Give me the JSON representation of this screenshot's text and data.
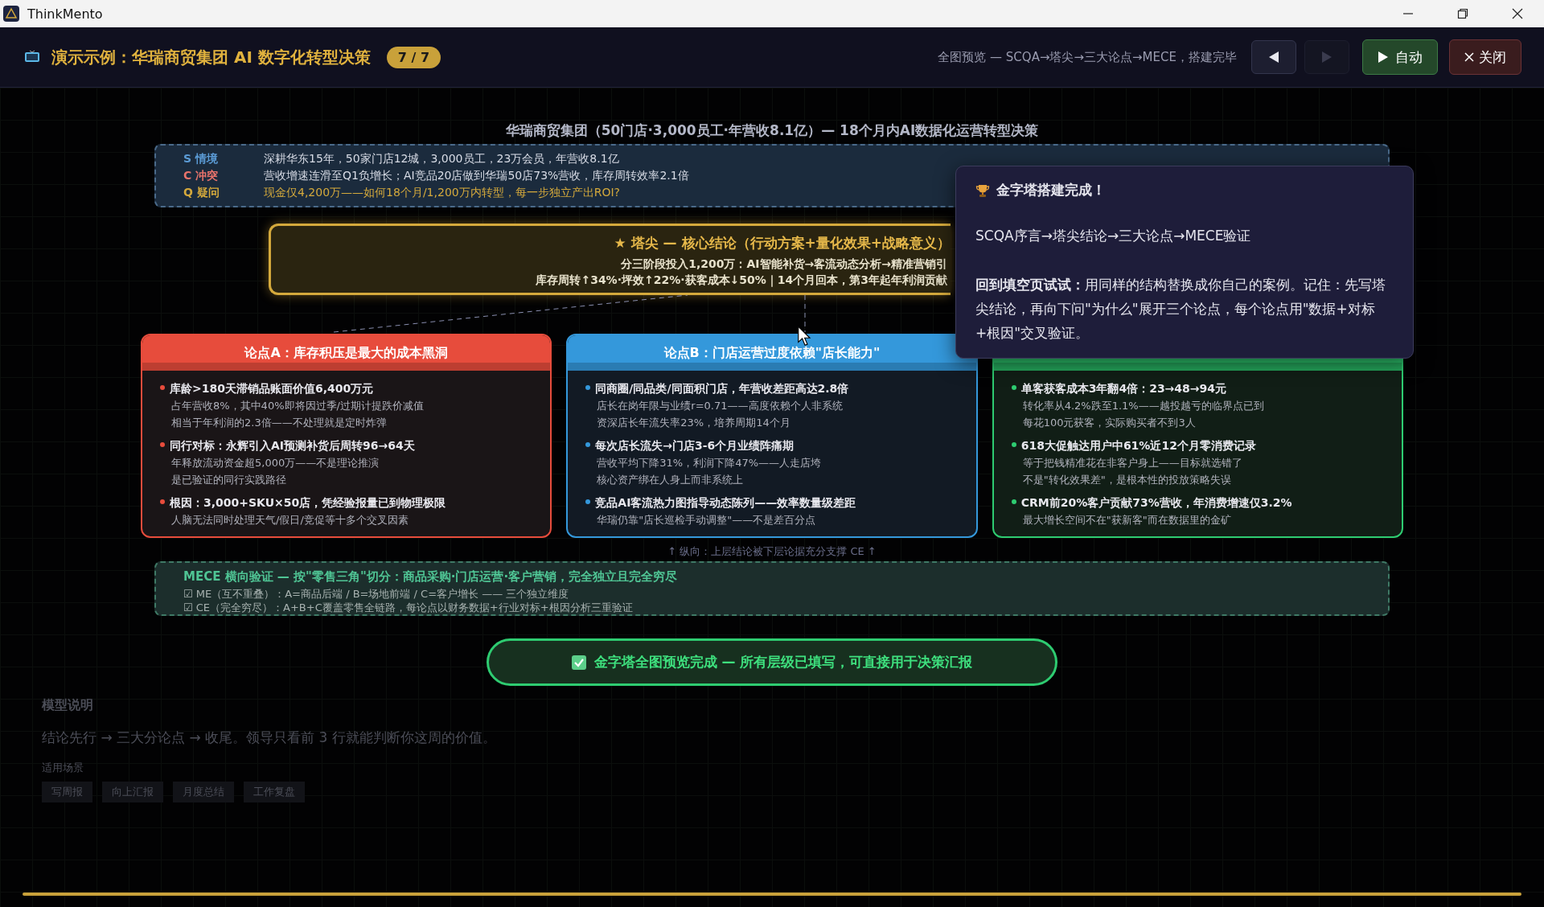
{
  "window": {
    "title": "ThinkMento"
  },
  "header": {
    "title": "演示示例：华瑞商贸集团 AI 数字化转型决策",
    "step": "7 / 7",
    "caption": "全图预览 — SCQA→塔尖→三大论点→MECE，搭建完毕",
    "prev_disabled": false,
    "next_disabled": true,
    "auto_label": "自动",
    "close_label": "关闭"
  },
  "pyramid": {
    "title": "华瑞商贸集团（50门店·3,000员工·年营收8.1亿）— 18个月内AI数据化运营转型决策",
    "scqa": [
      {
        "key": "S 情境",
        "text": "深耕华东15年，50家门店12城，3,000员工，23万会员，年营收8.1亿",
        "color": "#5b9bd5"
      },
      {
        "key": "C 冲突",
        "text": "营收增速连滑至Q1负增长；AI竞品20店做到华瑞50店73%营收，库存周转效率2.1倍",
        "color": "#e8736b"
      },
      {
        "key": "Q 疑问",
        "text": "现金仅4,200万——如何18个月/1,200万内转型，每一步独立产出ROI?",
        "color": "#d4a93c"
      }
    ],
    "apex": {
      "title": "★ 塔尖 — 核心结论（行动方案+量化效果+战略意义）",
      "lines": [
        "分三阶段投入1,200万：AI智能补货→客流动态分析→精准营销引",
        "库存周转↑34%·坪效↑22%·获客成本↓50%｜14个月回本，第3年起年利润贡献"
      ]
    },
    "arguments": [
      {
        "title": "论点A：库存积压是最大的成本黑洞",
        "color": "#e74c3c",
        "points": [
          {
            "head": "库龄>180天滞销品账面价值6,400万元",
            "lines": [
              "占年营收8%，其中40%即将因过季/过期计提跌价减值",
              "相当于年利润的2.3倍——不处理就是定时炸弹"
            ]
          },
          {
            "head": "同行对标：永辉引入AI预测补货后周转96→64天",
            "lines": [
              "年释放流动资金超5,000万——不是理论推演",
              "是已验证的同行实践路径"
            ]
          },
          {
            "head": "根因：3,000+SKU×50店，凭经验报量已到物理极限",
            "lines": [
              "人脑无法同时处理天气/假日/竞促等十多个交叉因素"
            ]
          }
        ]
      },
      {
        "title": "论点B：门店运营过度依赖\"店长能力\"",
        "color": "#3498db",
        "points": [
          {
            "head": "同商圈/同品类/同面积门店，年营收差距高达2.8倍",
            "lines": [
              "店长在岗年限与业绩r=0.71——高度依赖个人非系统",
              "资深店长年流失率23%，培养周期14个月"
            ]
          },
          {
            "head": "每次店长流失→门店3-6个月业绩阵痛期",
            "lines": [
              "营收平均下降31%，利润下降47%——人走店垮",
              "核心资产绑在人身上而非系统上"
            ]
          },
          {
            "head": "竞品AI客流热力图指导动态陈列——效率数量级差距",
            "lines": [
              "华瑞仍靠\"店长巡检手动调整\"——不是差百分点"
            ]
          }
        ]
      },
      {
        "color": "#2ecc71",
        "points": [
          {
            "head": "单客获客成本3年翻4倍：23→48→94元",
            "lines": [
              "转化率从4.2%跌至1.1%——越投越亏的临界点已到",
              "每花100元获客，实际购买者不到3人"
            ]
          },
          {
            "head": "618大促触达用户中61%近12个月零消费记录",
            "lines": [
              "等于把钱精准花在非客户身上——目标就选错了",
              "不是\"转化效果差\"，是根本性的投放策略失误"
            ]
          },
          {
            "head": "CRM前20%客户贡献73%营收，年消费增速仅3.2%",
            "lines": [
              "最大增长空间不在\"获新客\"而在数据里的金矿"
            ]
          }
        ]
      }
    ],
    "vertical_note": "↑ 纵向：上层结论被下层论据充分支撑 CE ↑",
    "mece": {
      "title": "MECE 横向验证 — 按\"零售三角\"切分：商品采购·门店运营·客户营销，完全独立且完全穷尽",
      "lines": [
        "☑ ME（互不重叠）：A=商品后端 / B=场地前端 / C=客户增长 —— 三个独立维度",
        "☑ CE（完全穷尽）：A+B+C覆盖零售全链路，每论点以财务数据+行业对标+根因分析三重验证"
      ]
    },
    "done": {
      "text": "金字塔全图预览完成 — 所有层级已填写，可直接用于决策汇报",
      "checked": true
    }
  },
  "popup": {
    "title": "金字塔搭建完成！",
    "flow": "SCQA序言→塔尖结论→三大论点→MECE验证",
    "tip": "**回到填空页试试：**用同样的结构替换成你自己的案例。记住：先写塔尖结论，再向下问\"为什么\"展开三个论点，每个论点用\"数据+对标+根因\"交叉验证。"
  },
  "background": {
    "heading": "模型说明",
    "text": "结论先行 → 三大分论点 → 收尾。领导只看前 3 行就能判断你这周的价值。",
    "scenes_label": "适用场景",
    "tags": [
      "写周报",
      "向上汇报",
      "月度总结",
      "工作复盘"
    ]
  }
}
